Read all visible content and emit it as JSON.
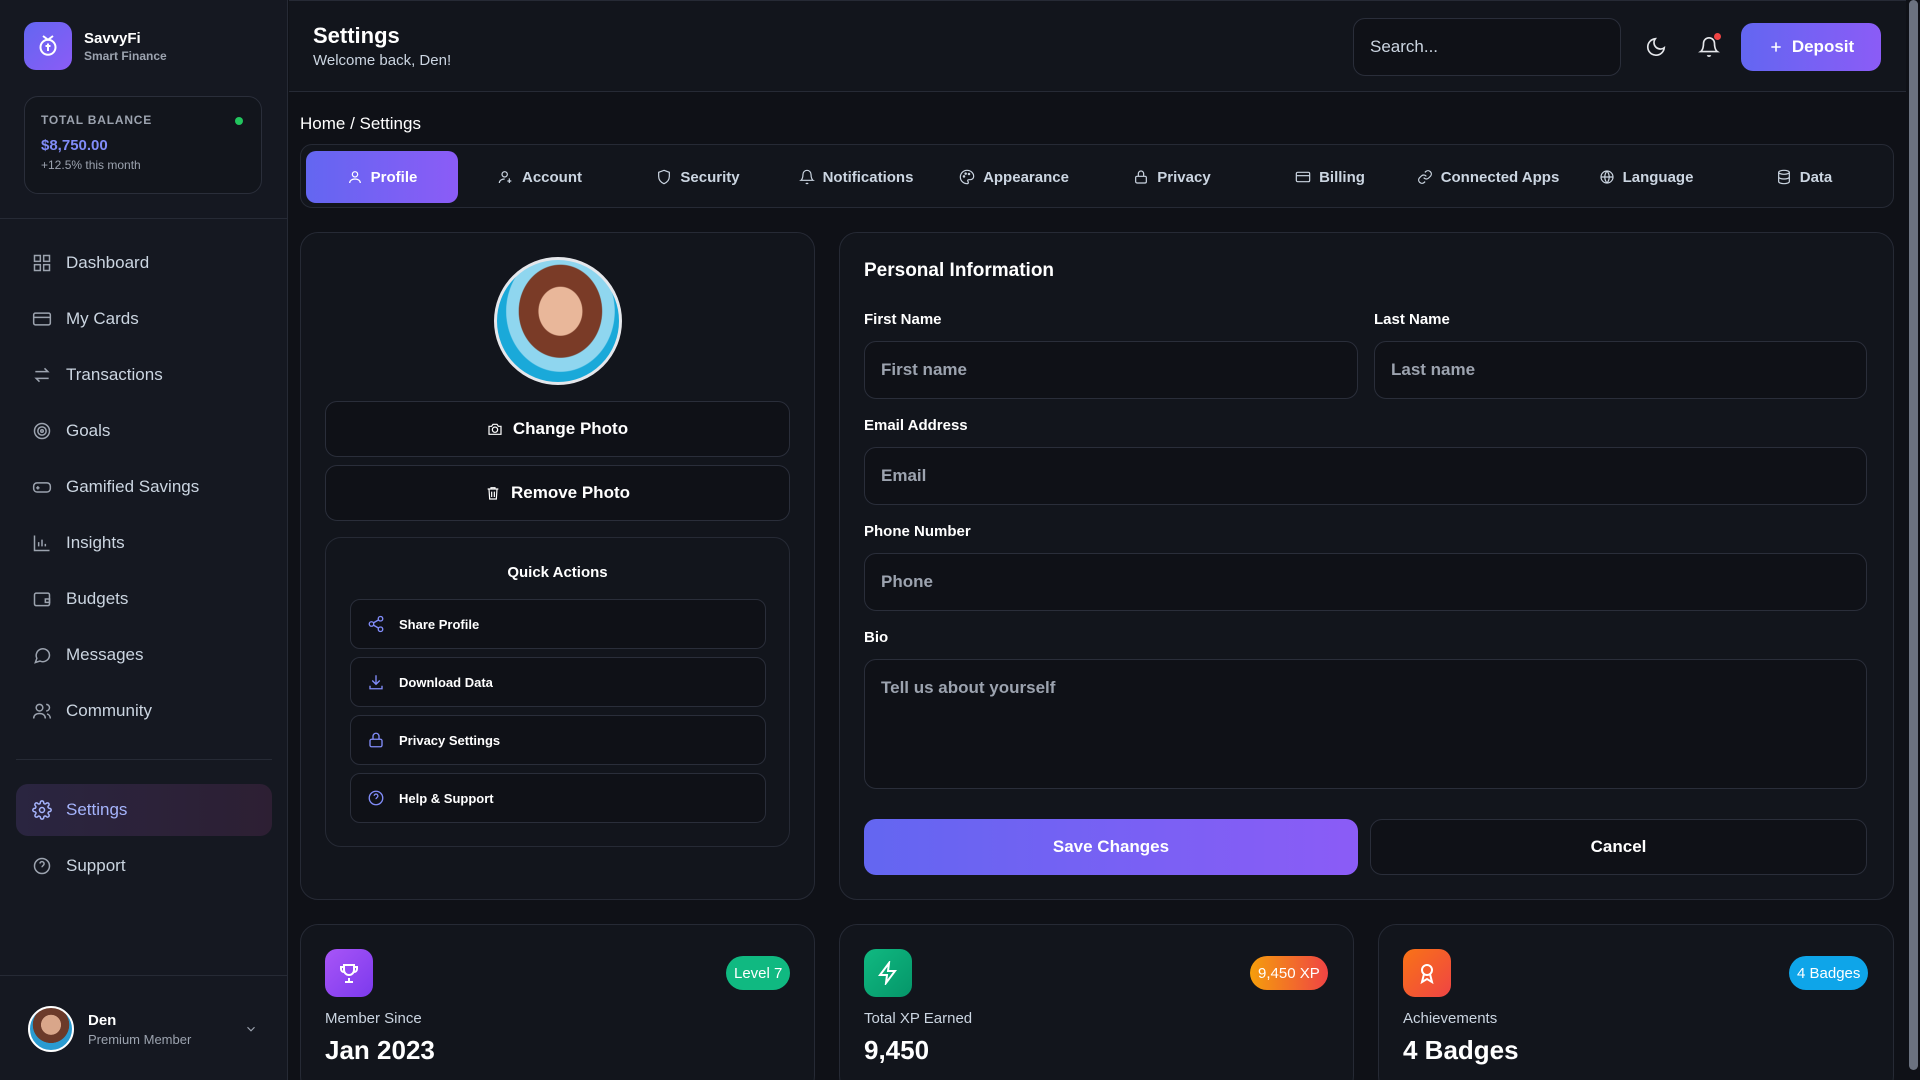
{
  "brand": {
    "name": "SavvyFi",
    "tagline": "Smart Finance"
  },
  "balance": {
    "label": "TOTAL BALANCE",
    "value": "$8,750.00",
    "change": "+12.5% this month"
  },
  "sidebar": {
    "items": [
      {
        "label": "Dashboard",
        "icon": "dashboard-icon"
      },
      {
        "label": "My Cards",
        "icon": "card-icon"
      },
      {
        "label": "Transactions",
        "icon": "transfer-icon"
      },
      {
        "label": "Goals",
        "icon": "target-icon"
      },
      {
        "label": "Gamified Savings",
        "icon": "gamepad-icon"
      },
      {
        "label": "Insights",
        "icon": "chart-icon"
      },
      {
        "label": "Budgets",
        "icon": "wallet-icon"
      },
      {
        "label": "Messages",
        "icon": "message-icon"
      },
      {
        "label": "Community",
        "icon": "users-icon"
      }
    ],
    "secondary": [
      {
        "label": "Settings",
        "icon": "gear-icon",
        "active": true
      },
      {
        "label": "Support",
        "icon": "help-icon"
      }
    ]
  },
  "user": {
    "name": "Den",
    "role": "Premium Member"
  },
  "header": {
    "title": "Settings",
    "subtitle": "Welcome back, Den!",
    "search_placeholder": "Search...",
    "deposit_label": "Deposit"
  },
  "breadcrumb": "Home / Settings",
  "tabs": [
    {
      "label": "Profile",
      "icon": "user-icon",
      "active": true
    },
    {
      "label": "Account",
      "icon": "account-icon"
    },
    {
      "label": "Security",
      "icon": "shield-icon"
    },
    {
      "label": "Notifications",
      "icon": "bell-icon"
    },
    {
      "label": "Appearance",
      "icon": "palette-icon"
    },
    {
      "label": "Privacy",
      "icon": "lock-icon"
    },
    {
      "label": "Billing",
      "icon": "card-icon"
    },
    {
      "label": "Connected Apps",
      "icon": "link-icon"
    },
    {
      "label": "Language",
      "icon": "globe-icon"
    },
    {
      "label": "Data",
      "icon": "database-icon"
    }
  ],
  "profile": {
    "change_photo": "Change Photo",
    "remove_photo": "Remove Photo",
    "quick_actions_title": "Quick Actions",
    "quick_actions": [
      {
        "label": "Share Profile",
        "icon": "share-icon"
      },
      {
        "label": "Download Data",
        "icon": "download-icon"
      },
      {
        "label": "Privacy Settings",
        "icon": "lock-icon"
      },
      {
        "label": "Help & Support",
        "icon": "help-icon"
      }
    ]
  },
  "personal": {
    "title": "Personal Information",
    "first_name_label": "First Name",
    "first_name_placeholder": "First name",
    "first_name_value": "",
    "last_name_label": "Last Name",
    "last_name_placeholder": "Last name",
    "last_name_value": "",
    "email_label": "Email Address",
    "email_placeholder": "Email",
    "email_value": "",
    "phone_label": "Phone Number",
    "phone_placeholder": "Phone",
    "phone_value": "",
    "bio_label": "Bio",
    "bio_placeholder": "Tell us about yourself",
    "bio_value": "",
    "save_label": "Save Changes",
    "cancel_label": "Cancel"
  },
  "stats": [
    {
      "label": "Member Since",
      "value": "Jan 2023",
      "badge": "Level 7",
      "icon": "trophy-icon",
      "color": "#8b5cf6",
      "badge_color": "#10b981"
    },
    {
      "label": "Total XP Earned",
      "value": "9,450",
      "badge": "9,450 XP",
      "icon": "lightning-icon",
      "color": "#10b981",
      "badge_color": "#f97316"
    },
    {
      "label": "Achievements",
      "value": "4 Badges",
      "badge": "4 Badges",
      "icon": "award-icon",
      "color": "#f97316",
      "badge_color": "#0ea5e9"
    }
  ],
  "colors": {
    "accent": "#6366f1",
    "accent2": "#8b5cf6",
    "bg": "#0f1117",
    "panel": "#12151c"
  }
}
